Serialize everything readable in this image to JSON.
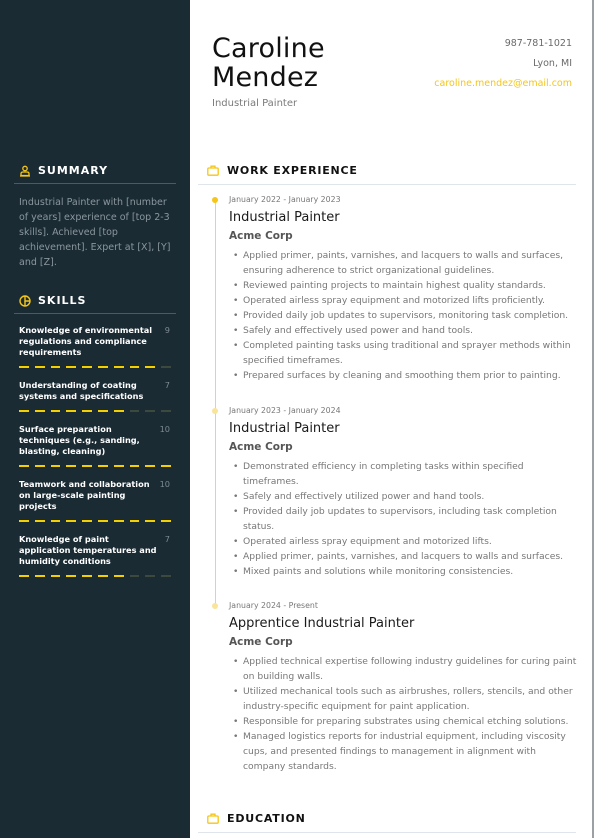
{
  "header": {
    "name_line1": "Caroline",
    "name_line2": "Mendez",
    "job_title": "Industrial Painter",
    "contact": {
      "phone": "987-781-1021",
      "location": "Lyon, MI",
      "email": "caroline.mendez@email.com"
    }
  },
  "colors": {
    "sidebar_bg": "#1b2b34",
    "accent": "#f5c518",
    "skill_dash_on": "#f5d000",
    "skill_dash_off": "#3b4a3c"
  },
  "sidebar": {
    "summary": {
      "heading": "SUMMARY",
      "icon": "user-icon",
      "text": "Industrial Painter with [number of years] experience of [top 2-3 skills]. Achieved [top achievement]. Expert at [X], [Y] and [Z]."
    },
    "skills": {
      "heading": "SKILLS",
      "icon": "chart-pie-icon",
      "max": 10,
      "items": [
        {
          "name": "Knowledge of environmental regulations and compliance requirements",
          "score": 9
        },
        {
          "name": "Understanding of coating systems and specifications",
          "score": 7
        },
        {
          "name": "Surface preparation techniques (e.g., sanding, blasting, cleaning)",
          "score": 10
        },
        {
          "name": "Teamwork and collaboration on large-scale painting projects",
          "score": 10
        },
        {
          "name": "Knowledge of paint application temperatures and humidity conditions",
          "score": 7
        }
      ]
    }
  },
  "work": {
    "heading": "WORK EXPERIENCE",
    "icon": "briefcase-icon",
    "jobs": [
      {
        "dates": "January 2022 - January 2023",
        "role": "Industrial Painter",
        "company": "Acme Corp",
        "bullets": [
          "Applied primer, paints, varnishes, and lacquers to walls and surfaces, ensuring adherence to strict organizational guidelines.",
          "Reviewed painting projects to maintain highest quality standards.",
          "Operated airless spray equipment and motorized lifts proficiently.",
          "Provided daily job updates to supervisors, monitoring task completion.",
          "Safely and effectively used power and hand tools.",
          "Completed painting tasks using traditional and sprayer methods within specified timeframes.",
          "Prepared surfaces by cleaning and smoothing them prior to painting."
        ]
      },
      {
        "dates": "January 2023 - January 2024",
        "role": "Industrial Painter",
        "company": "Acme Corp",
        "bullets": [
          "Demonstrated efficiency in completing tasks within specified timeframes.",
          "Safely and effectively utilized power and hand tools.",
          "Provided daily job updates to supervisors, including task completion status.",
          "Operated airless spray equipment and motorized lifts.",
          "Applied primer, paints, varnishes, and lacquers to walls and surfaces.",
          "Mixed paints and solutions while monitoring consistencies."
        ]
      },
      {
        "dates": "January 2024 - Present",
        "role": "Apprentice Industrial Painter",
        "company": "Acme Corp",
        "bullets": [
          "Applied technical expertise following industry guidelines for curing paint on building walls.",
          "Utilized mechanical tools such as airbrushes, rollers, stencils, and other industry-specific equipment for paint application.",
          "Responsible for preparing substrates using chemical etching solutions.",
          "Managed logistics reports for industrial equipment, including viscosity cups, and presented findings to management in alignment with company standards."
        ]
      }
    ]
  },
  "education": {
    "heading": "EDUCATION",
    "icon": "briefcase-icon"
  }
}
